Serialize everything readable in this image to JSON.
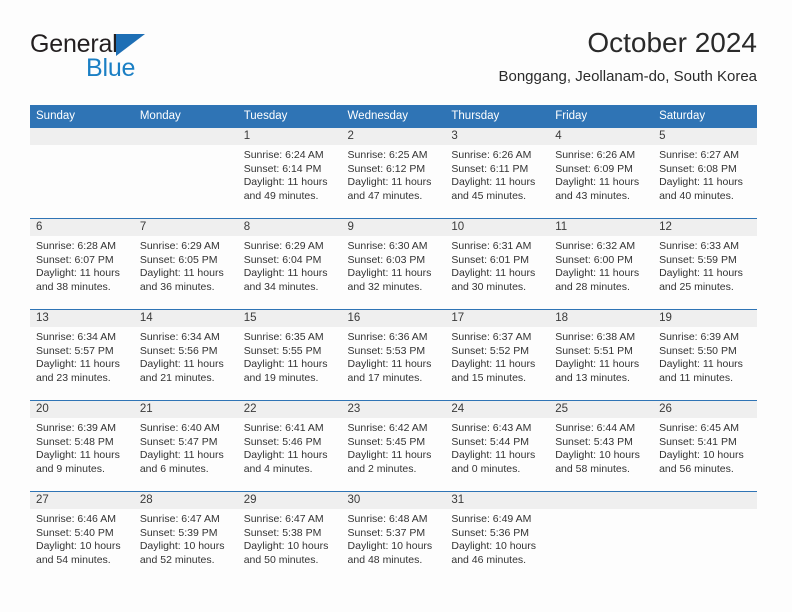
{
  "logo": {
    "line1": "General",
    "line2": "Blue",
    "triangle_icon": "blue-triangle-icon",
    "accent_color": "#1b7fc4"
  },
  "header": {
    "title": "October 2024",
    "subtitle": "Bonggang, Jeollanam-do, South Korea"
  },
  "theme": {
    "header_blue": "#2f74b5",
    "daynum_gray": "#efefef",
    "text": "#333333"
  },
  "calendar": {
    "weekday_headers": [
      "Sunday",
      "Monday",
      "Tuesday",
      "Wednesday",
      "Thursday",
      "Friday",
      "Saturday"
    ],
    "weeks": [
      [
        {
          "day": "",
          "sunrise": "",
          "sunset": "",
          "daylight_line1": "",
          "daylight_line2": ""
        },
        {
          "day": "",
          "sunrise": "",
          "sunset": "",
          "daylight_line1": "",
          "daylight_line2": ""
        },
        {
          "day": "1",
          "sunrise": "Sunrise: 6:24 AM",
          "sunset": "Sunset: 6:14 PM",
          "daylight_line1": "Daylight: 11 hours",
          "daylight_line2": "and 49 minutes."
        },
        {
          "day": "2",
          "sunrise": "Sunrise: 6:25 AM",
          "sunset": "Sunset: 6:12 PM",
          "daylight_line1": "Daylight: 11 hours",
          "daylight_line2": "and 47 minutes."
        },
        {
          "day": "3",
          "sunrise": "Sunrise: 6:26 AM",
          "sunset": "Sunset: 6:11 PM",
          "daylight_line1": "Daylight: 11 hours",
          "daylight_line2": "and 45 minutes."
        },
        {
          "day": "4",
          "sunrise": "Sunrise: 6:26 AM",
          "sunset": "Sunset: 6:09 PM",
          "daylight_line1": "Daylight: 11 hours",
          "daylight_line2": "and 43 minutes."
        },
        {
          "day": "5",
          "sunrise": "Sunrise: 6:27 AM",
          "sunset": "Sunset: 6:08 PM",
          "daylight_line1": "Daylight: 11 hours",
          "daylight_line2": "and 40 minutes."
        }
      ],
      [
        {
          "day": "6",
          "sunrise": "Sunrise: 6:28 AM",
          "sunset": "Sunset: 6:07 PM",
          "daylight_line1": "Daylight: 11 hours",
          "daylight_line2": "and 38 minutes."
        },
        {
          "day": "7",
          "sunrise": "Sunrise: 6:29 AM",
          "sunset": "Sunset: 6:05 PM",
          "daylight_line1": "Daylight: 11 hours",
          "daylight_line2": "and 36 minutes."
        },
        {
          "day": "8",
          "sunrise": "Sunrise: 6:29 AM",
          "sunset": "Sunset: 6:04 PM",
          "daylight_line1": "Daylight: 11 hours",
          "daylight_line2": "and 34 minutes."
        },
        {
          "day": "9",
          "sunrise": "Sunrise: 6:30 AM",
          "sunset": "Sunset: 6:03 PM",
          "daylight_line1": "Daylight: 11 hours",
          "daylight_line2": "and 32 minutes."
        },
        {
          "day": "10",
          "sunrise": "Sunrise: 6:31 AM",
          "sunset": "Sunset: 6:01 PM",
          "daylight_line1": "Daylight: 11 hours",
          "daylight_line2": "and 30 minutes."
        },
        {
          "day": "11",
          "sunrise": "Sunrise: 6:32 AM",
          "sunset": "Sunset: 6:00 PM",
          "daylight_line1": "Daylight: 11 hours",
          "daylight_line2": "and 28 minutes."
        },
        {
          "day": "12",
          "sunrise": "Sunrise: 6:33 AM",
          "sunset": "Sunset: 5:59 PM",
          "daylight_line1": "Daylight: 11 hours",
          "daylight_line2": "and 25 minutes."
        }
      ],
      [
        {
          "day": "13",
          "sunrise": "Sunrise: 6:34 AM",
          "sunset": "Sunset: 5:57 PM",
          "daylight_line1": "Daylight: 11 hours",
          "daylight_line2": "and 23 minutes."
        },
        {
          "day": "14",
          "sunrise": "Sunrise: 6:34 AM",
          "sunset": "Sunset: 5:56 PM",
          "daylight_line1": "Daylight: 11 hours",
          "daylight_line2": "and 21 minutes."
        },
        {
          "day": "15",
          "sunrise": "Sunrise: 6:35 AM",
          "sunset": "Sunset: 5:55 PM",
          "daylight_line1": "Daylight: 11 hours",
          "daylight_line2": "and 19 minutes."
        },
        {
          "day": "16",
          "sunrise": "Sunrise: 6:36 AM",
          "sunset": "Sunset: 5:53 PM",
          "daylight_line1": "Daylight: 11 hours",
          "daylight_line2": "and 17 minutes."
        },
        {
          "day": "17",
          "sunrise": "Sunrise: 6:37 AM",
          "sunset": "Sunset: 5:52 PM",
          "daylight_line1": "Daylight: 11 hours",
          "daylight_line2": "and 15 minutes."
        },
        {
          "day": "18",
          "sunrise": "Sunrise: 6:38 AM",
          "sunset": "Sunset: 5:51 PM",
          "daylight_line1": "Daylight: 11 hours",
          "daylight_line2": "and 13 minutes."
        },
        {
          "day": "19",
          "sunrise": "Sunrise: 6:39 AM",
          "sunset": "Sunset: 5:50 PM",
          "daylight_line1": "Daylight: 11 hours",
          "daylight_line2": "and 11 minutes."
        }
      ],
      [
        {
          "day": "20",
          "sunrise": "Sunrise: 6:39 AM",
          "sunset": "Sunset: 5:48 PM",
          "daylight_line1": "Daylight: 11 hours",
          "daylight_line2": "and 9 minutes."
        },
        {
          "day": "21",
          "sunrise": "Sunrise: 6:40 AM",
          "sunset": "Sunset: 5:47 PM",
          "daylight_line1": "Daylight: 11 hours",
          "daylight_line2": "and 6 minutes."
        },
        {
          "day": "22",
          "sunrise": "Sunrise: 6:41 AM",
          "sunset": "Sunset: 5:46 PM",
          "daylight_line1": "Daylight: 11 hours",
          "daylight_line2": "and 4 minutes."
        },
        {
          "day": "23",
          "sunrise": "Sunrise: 6:42 AM",
          "sunset": "Sunset: 5:45 PM",
          "daylight_line1": "Daylight: 11 hours",
          "daylight_line2": "and 2 minutes."
        },
        {
          "day": "24",
          "sunrise": "Sunrise: 6:43 AM",
          "sunset": "Sunset: 5:44 PM",
          "daylight_line1": "Daylight: 11 hours",
          "daylight_line2": "and 0 minutes."
        },
        {
          "day": "25",
          "sunrise": "Sunrise: 6:44 AM",
          "sunset": "Sunset: 5:43 PM",
          "daylight_line1": "Daylight: 10 hours",
          "daylight_line2": "and 58 minutes."
        },
        {
          "day": "26",
          "sunrise": "Sunrise: 6:45 AM",
          "sunset": "Sunset: 5:41 PM",
          "daylight_line1": "Daylight: 10 hours",
          "daylight_line2": "and 56 minutes."
        }
      ],
      [
        {
          "day": "27",
          "sunrise": "Sunrise: 6:46 AM",
          "sunset": "Sunset: 5:40 PM",
          "daylight_line1": "Daylight: 10 hours",
          "daylight_line2": "and 54 minutes."
        },
        {
          "day": "28",
          "sunrise": "Sunrise: 6:47 AM",
          "sunset": "Sunset: 5:39 PM",
          "daylight_line1": "Daylight: 10 hours",
          "daylight_line2": "and 52 minutes."
        },
        {
          "day": "29",
          "sunrise": "Sunrise: 6:47 AM",
          "sunset": "Sunset: 5:38 PM",
          "daylight_line1": "Daylight: 10 hours",
          "daylight_line2": "and 50 minutes."
        },
        {
          "day": "30",
          "sunrise": "Sunrise: 6:48 AM",
          "sunset": "Sunset: 5:37 PM",
          "daylight_line1": "Daylight: 10 hours",
          "daylight_line2": "and 48 minutes."
        },
        {
          "day": "31",
          "sunrise": "Sunrise: 6:49 AM",
          "sunset": "Sunset: 5:36 PM",
          "daylight_line1": "Daylight: 10 hours",
          "daylight_line2": "and 46 minutes."
        },
        {
          "day": "",
          "sunrise": "",
          "sunset": "",
          "daylight_line1": "",
          "daylight_line2": ""
        },
        {
          "day": "",
          "sunrise": "",
          "sunset": "",
          "daylight_line1": "",
          "daylight_line2": ""
        }
      ]
    ]
  }
}
